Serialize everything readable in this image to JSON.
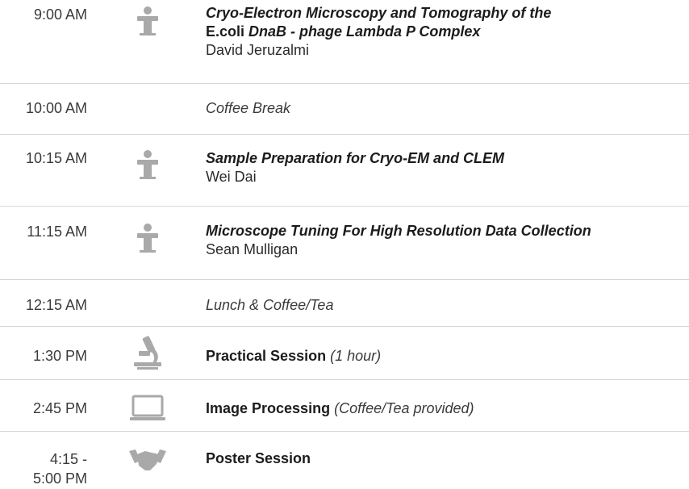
{
  "rows": [
    {
      "time": "9:00 AM",
      "title_italic_1": "Cryo-Electron Microscopy and Tomography of the",
      "title_plain": "E.coli",
      "title_italic_2": "DnaB - phage Lambda P Complex",
      "speaker": "David Jeruzalmi",
      "icon": "podium-icon"
    },
    {
      "time": "10:00 AM",
      "text": "Coffee Break"
    },
    {
      "time": "10:15 AM",
      "title": "Sample Preparation for Cryo-EM and CLEM",
      "speaker": "Wei Dai",
      "icon": "podium-icon"
    },
    {
      "time": "11:15 AM",
      "title": "Microscope Tuning For High Resolution Data Collection",
      "speaker": "Sean Mulligan",
      "icon": "podium-icon"
    },
    {
      "time": "12:15 AM",
      "text": "Lunch & Coffee/Tea"
    },
    {
      "time": "1:30 PM",
      "title": "Practical Session",
      "note": "(1 hour)",
      "icon": "microscope-icon"
    },
    {
      "time": "2:45 PM",
      "title": "Image Processing",
      "note": "(Coffee/Tea provided)",
      "icon": "laptop-icon"
    },
    {
      "time_line1": "4:15 -",
      "time_line2": "5:00 PM",
      "title": "Poster Session",
      "icon": "handshake-icon"
    }
  ],
  "colors": {
    "divider": "#d6d6d6",
    "icon": "#a9a9a9",
    "text": "#2b2b2b"
  }
}
